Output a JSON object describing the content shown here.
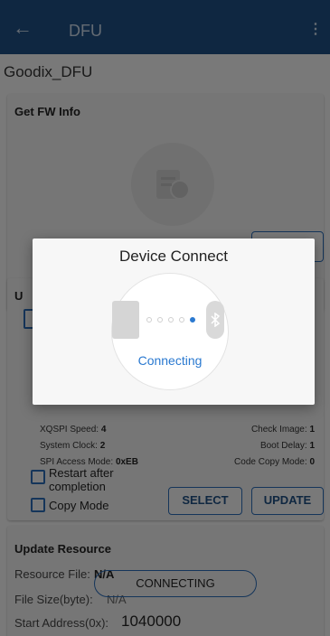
{
  "appbar": {
    "back_icon": "←",
    "title": "DFU",
    "menu_icon": "⋮"
  },
  "device_name": "Goodix_DFU",
  "fw_card": {
    "title": "Get FW Info"
  },
  "update_card": {
    "title_partial": "U",
    "xqspi_label": "XQSPI Speed:",
    "xqspi_value": "4",
    "check_label": "Check Image:",
    "check_value": "1",
    "sysclock_label": "System Clock:",
    "sysclock_value": "2",
    "bootdelay_label": "Boot Delay:",
    "bootdelay_value": "1",
    "spi_label": "SPI Access Mode:",
    "spi_value": "0xEB",
    "codecopy_label": "Code Copy Mode:",
    "codecopy_value": "0",
    "restart_label": "Restart after completion",
    "copymode_label": "Copy Mode",
    "select_label": "SELECT",
    "update_label": "UPDATE"
  },
  "resource_card": {
    "title": "Update Resource",
    "file_label": "Resource File:",
    "file_value": "N/A",
    "size_label": "File Size(byte):",
    "size_value": "N/A",
    "addr_label": "Start Address(0x):",
    "addr_value": "1040000"
  },
  "connecting_button": "CONNECTING",
  "dialog": {
    "title": "Device Connect",
    "status": "Connecting"
  },
  "colors": {
    "primary": "#1f4f82",
    "accent": "#2a79d0"
  }
}
